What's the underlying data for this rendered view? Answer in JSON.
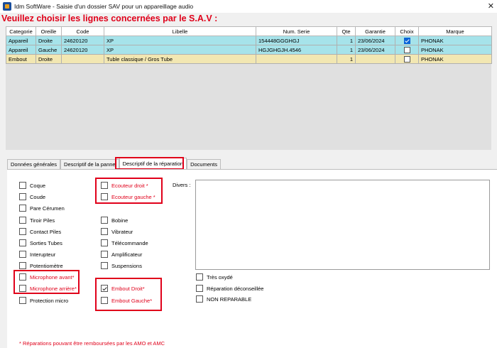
{
  "window": {
    "title": "Idm SoftWare - Saisie d'un dossier SAV pour un appareillage audio",
    "close": "✕"
  },
  "heading": "Veuillez choisir les lignes concernées par le S.A.V :",
  "grid": {
    "headers": [
      "Categorie",
      "Oreille",
      "Code",
      "Libelle",
      "Num. Serie",
      "Qte",
      "Garantie",
      "Choix",
      "Marque"
    ],
    "rows": [
      {
        "categorie": "Appareil",
        "oreille": "Droite",
        "code": "24620120",
        "libelle": "XP",
        "serie": "154448GGGHGJ",
        "qte": "1",
        "garantie": "23/06/2024",
        "choix": true,
        "marque": "PHONAK"
      },
      {
        "categorie": "Appareil",
        "oreille": "Gauche",
        "code": "24620120",
        "libelle": "XP",
        "serie": "HGJGHGJH.4546",
        "qte": "1",
        "garantie": "23/06/2024",
        "choix": false,
        "marque": "PHONAK"
      },
      {
        "categorie": "Embout",
        "oreille": "Droite",
        "code": "",
        "libelle": "Tuble classique / Gros Tube",
        "serie": "",
        "qte": "1",
        "garantie": "",
        "choix": false,
        "marque": "PHONAK"
      }
    ]
  },
  "tabs": [
    "Données générales",
    "Descriptif de la panne",
    "Descriptif de la réparation",
    "Documents"
  ],
  "col1": [
    "Coque",
    "Coude",
    "Pare Cérumen",
    "Tiroir Piles",
    "Contact Piles",
    "Sorties Tubes",
    "Interupteur",
    "Potentiomètre",
    "Microphone avant*",
    "Microphone arrière*",
    "Protection micro"
  ],
  "col2_top": [
    "Ecouteur droit *",
    "Ecouteur gauche *"
  ],
  "col2": [
    "Bobine",
    "Vibrateur",
    "Télécommande",
    "Amplificateur",
    "Suspensions"
  ],
  "col2_bottom": [
    "Embout Droit*",
    "Embout Gauche*"
  ],
  "col2_bottom_checked": [
    true,
    false
  ],
  "divers_label": "Divers :",
  "col3": [
    "Très oxydé",
    "Réparation déconseillée",
    "NON REPARABLE"
  ],
  "footnote": "* Réparations pouvant être remboursées par les AMO et AMC",
  "colors": {
    "accent_red": "#e0001a",
    "selected_row": "#a6e3ea",
    "embout_row": "#f2e7b2",
    "check_blue": "#0a64d8"
  }
}
